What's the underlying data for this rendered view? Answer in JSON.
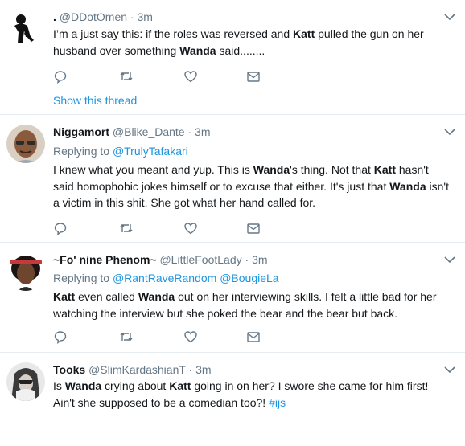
{
  "tweets": [
    {
      "name": ".",
      "handle": "@DDotOmen",
      "separator": "·",
      "time": "3m",
      "replying_label": "",
      "reply_mentions": [],
      "text_parts": [
        {
          "t": "I’m a just say this: if the roles was reversed and ",
          "b": false
        },
        {
          "t": "Katt",
          "b": true
        },
        {
          "t": " pulled the gun on her husband over something ",
          "b": false
        },
        {
          "t": "Wanda",
          "b": true
        },
        {
          "t": " said........",
          "b": false
        }
      ],
      "show_thread": "Show this thread",
      "avatar_icon": "silhouette-avatar"
    },
    {
      "name": "Niggamort",
      "handle": "@Blike_Dante",
      "separator": "·",
      "time": "3m",
      "replying_label": "Replying to",
      "reply_mentions": [
        "@TrulyTafakari"
      ],
      "text_parts": [
        {
          "t": "I knew what you meant and yup. This is ",
          "b": false
        },
        {
          "t": "Wanda",
          "b": true
        },
        {
          "t": "'s thing. Not that ",
          "b": false
        },
        {
          "t": "Katt",
          "b": true
        },
        {
          "t": " hasn't said homophobic jokes himself or to excuse that either. It's just that ",
          "b": false
        },
        {
          "t": "Wanda",
          "b": true
        },
        {
          "t": " isn't a victim in this shit. She got what her hand called for.",
          "b": false
        }
      ],
      "show_thread": "",
      "avatar_icon": "man-avatar"
    },
    {
      "name": "~Fo' nine Phenom~",
      "handle": "@LittleFootLady",
      "separator": "·",
      "time": "3m",
      "replying_label": "Replying to",
      "reply_mentions": [
        "@RantRaveRandom",
        "@BougieLa"
      ],
      "text_parts": [
        {
          "t": "Katt",
          "b": true
        },
        {
          "t": " even called ",
          "b": false
        },
        {
          "t": "Wanda",
          "b": true
        },
        {
          "t": " out on her interviewing skills. I felt a little bad for her watching the interview but she poked the bear and the bear but back.",
          "b": false
        }
      ],
      "show_thread": "",
      "avatar_icon": "woman-avatar"
    },
    {
      "name": "Tooks",
      "handle": "@SlimKardashianT",
      "separator": "·",
      "time": "3m",
      "replying_label": "",
      "reply_mentions": [],
      "text_parts": [
        {
          "t": "Is ",
          "b": false
        },
        {
          "t": "Wanda",
          "b": true
        },
        {
          "t": " crying about ",
          "b": false
        },
        {
          "t": "Katt",
          "b": true
        },
        {
          "t": " going in on her? I swore she came for him first! Ain't she supposed to be a comedian too?! ",
          "b": false
        },
        {
          "t": "#ijs",
          "b": false,
          "link": true
        }
      ],
      "show_thread": "",
      "avatar_icon": "hooded-avatar"
    }
  ],
  "actions": [
    "reply-icon",
    "retweet-icon",
    "like-icon",
    "message-icon"
  ],
  "colors": {
    "link": "#1b95e0",
    "muted": "#657786",
    "text": "#14171a",
    "border": "#e6ecf0"
  }
}
